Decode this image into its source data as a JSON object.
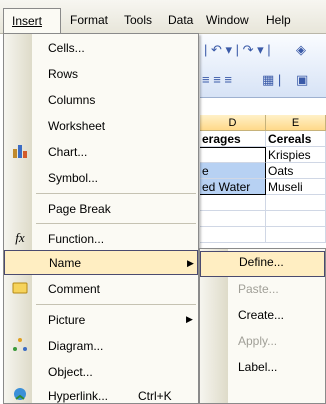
{
  "menubar": {
    "items": [
      {
        "label": "Insert",
        "mnemonic_index": 0
      },
      {
        "label": "Format",
        "mnemonic_index": 1
      },
      {
        "label": "Tools",
        "mnemonic_index": 0
      },
      {
        "label": "Data",
        "mnemonic_index": 0
      },
      {
        "label": "Window",
        "mnemonic_index": 0
      },
      {
        "label": "Help",
        "mnemonic_index": 0
      }
    ]
  },
  "sheet": {
    "col_headers": [
      "D",
      "E"
    ],
    "cells": {
      "d_header": "erages",
      "e_header": "Cereals",
      "e_row1": "Krispies",
      "e_row2": "Oats",
      "d_row2": "e",
      "d_row3": "ed Water",
      "e_row3": "Museli"
    }
  },
  "insert_menu": {
    "items": [
      {
        "label": "Cells...",
        "icon": ""
      },
      {
        "label": "Rows",
        "icon": ""
      },
      {
        "label": "Columns",
        "icon": ""
      },
      {
        "label": "Worksheet",
        "icon": ""
      },
      {
        "label": "Chart...",
        "icon": "chart-icon"
      },
      {
        "label": "Symbol...",
        "icon": ""
      },
      {
        "label": "Page Break",
        "icon": ""
      },
      {
        "label": "Function...",
        "icon": "function-icon"
      },
      {
        "label": "Name",
        "icon": "",
        "submenu": true,
        "active": true
      },
      {
        "label": "Comment",
        "icon": "comment-icon"
      },
      {
        "label": "Picture",
        "icon": "",
        "submenu": true
      },
      {
        "label": "Diagram...",
        "icon": "diagram-icon"
      },
      {
        "label": "Object...",
        "icon": ""
      },
      {
        "label": "Hyperlink...",
        "icon": "hyperlink-icon",
        "shortcut": "Ctrl+K"
      }
    ]
  },
  "name_submenu": {
    "items": [
      {
        "label": "Define...",
        "active": true,
        "disabled": false
      },
      {
        "label": "Paste...",
        "disabled": true
      },
      {
        "label": "Create...",
        "disabled": false
      },
      {
        "label": "Apply...",
        "disabled": true
      },
      {
        "label": "Label...",
        "disabled": false
      }
    ]
  },
  "colors": {
    "menu_bg": "#fbfaf4",
    "highlight_bg": "#ffeec2",
    "highlight_border": "#4b4b6f",
    "selection": "#b7d1f3"
  }
}
